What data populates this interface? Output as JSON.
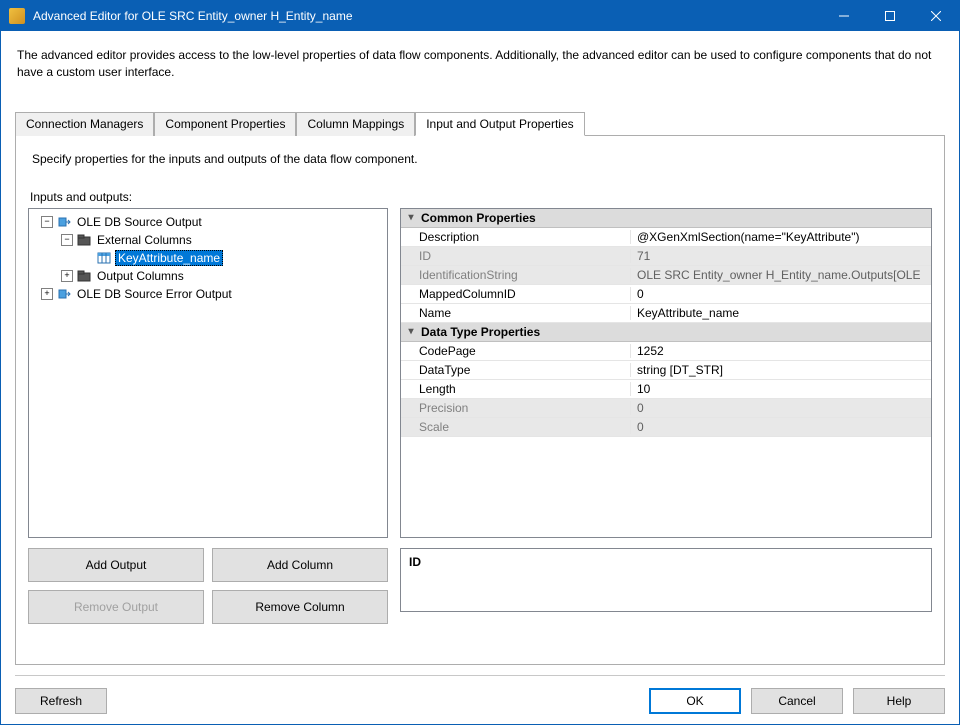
{
  "title": "Advanced Editor for OLE SRC Entity_owner H_Entity_name",
  "intro": "The advanced editor provides access to the low-level properties of data flow components. Additionally, the advanced editor can be used to configure components that do not have a custom user interface.",
  "tabs": {
    "t0": "Connection Managers",
    "t1": "Component Properties",
    "t2": "Column Mappings",
    "t3": "Input and Output Properties"
  },
  "tabDesc": "Specify properties for the inputs and outputs of the data flow component.",
  "ioLabel": "Inputs and outputs:",
  "tree": {
    "n0": "OLE DB Source Output",
    "n1": "External Columns",
    "n2": "KeyAttribute_name",
    "n3": "Output Columns",
    "n4": "OLE DB Source Error Output"
  },
  "buttons": {
    "addOutput": "Add Output",
    "addColumn": "Add Column",
    "removeOutput": "Remove Output",
    "removeColumn": "Remove Column"
  },
  "propCats": {
    "c0": "Common Properties",
    "c1": "Data Type Properties"
  },
  "props": {
    "r0n": "Description",
    "r0v": "@XGenXmlSection(name=\"KeyAttribute\")",
    "r1n": "ID",
    "r1v": "71",
    "r2n": "IdentificationString",
    "r2v": "OLE SRC Entity_owner H_Entity_name.Outputs[OLE ",
    "r3n": "MappedColumnID",
    "r3v": "0",
    "r4n": "Name",
    "r4v": "KeyAttribute_name",
    "r5n": "CodePage",
    "r5v": "1252",
    "r6n": "DataType",
    "r6v": "string [DT_STR]",
    "r7n": "Length",
    "r7v": "10",
    "r8n": "Precision",
    "r8v": "0",
    "r9n": "Scale",
    "r9v": "0"
  },
  "helpTitle": "ID",
  "footer": {
    "refresh": "Refresh",
    "ok": "OK",
    "cancel": "Cancel",
    "help": "Help"
  }
}
